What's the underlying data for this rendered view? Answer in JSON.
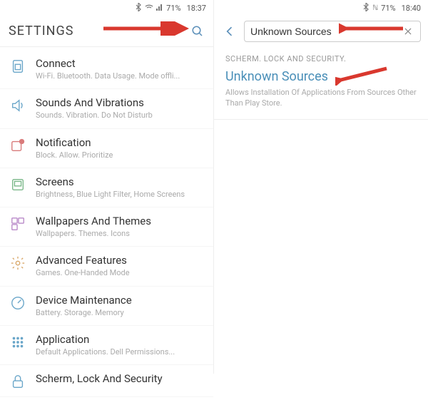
{
  "left": {
    "status": {
      "battery": "71%",
      "time": "18:37"
    },
    "header": {
      "title": "SETTINGS"
    },
    "items": [
      {
        "title": "Connect",
        "sub": "Wi-Fi. Bluetooth. Data Usage. Mode offli..."
      },
      {
        "title": "Sounds And Vibrations",
        "sub": "Sounds. Vibration. Do Not Disturb"
      },
      {
        "title": "Notification",
        "sub": "Block. Allow. Prioritize"
      },
      {
        "title": "Screens",
        "sub": "Brightness, Blue Light Filter, Home Screens"
      },
      {
        "title": "Wallpapers And Themes",
        "sub": "Wallpapers. Themes. Icons"
      },
      {
        "title": "Advanced Features",
        "sub": "Games. One-Handed Mode"
      },
      {
        "title": "Device Maintenance",
        "sub": "Battery. Storage. Memory"
      },
      {
        "title": "Application",
        "sub": "Default Applications. Dell Permissions..."
      },
      {
        "title": "Scherm, Lock And Security",
        "sub": ""
      }
    ]
  },
  "right": {
    "status": {
      "battery": "71%",
      "time": "18:40"
    },
    "search": {
      "value": "Unknown Sources"
    },
    "result": {
      "section": "SCHERM. LOCK AND SECURITY.",
      "title": "Unknown Sources",
      "sub": "Allows Installation Of Applications From Sources Other Than Play Store."
    }
  },
  "colors": {
    "accent": "#4a8fb8",
    "arrow": "#d9382e"
  }
}
